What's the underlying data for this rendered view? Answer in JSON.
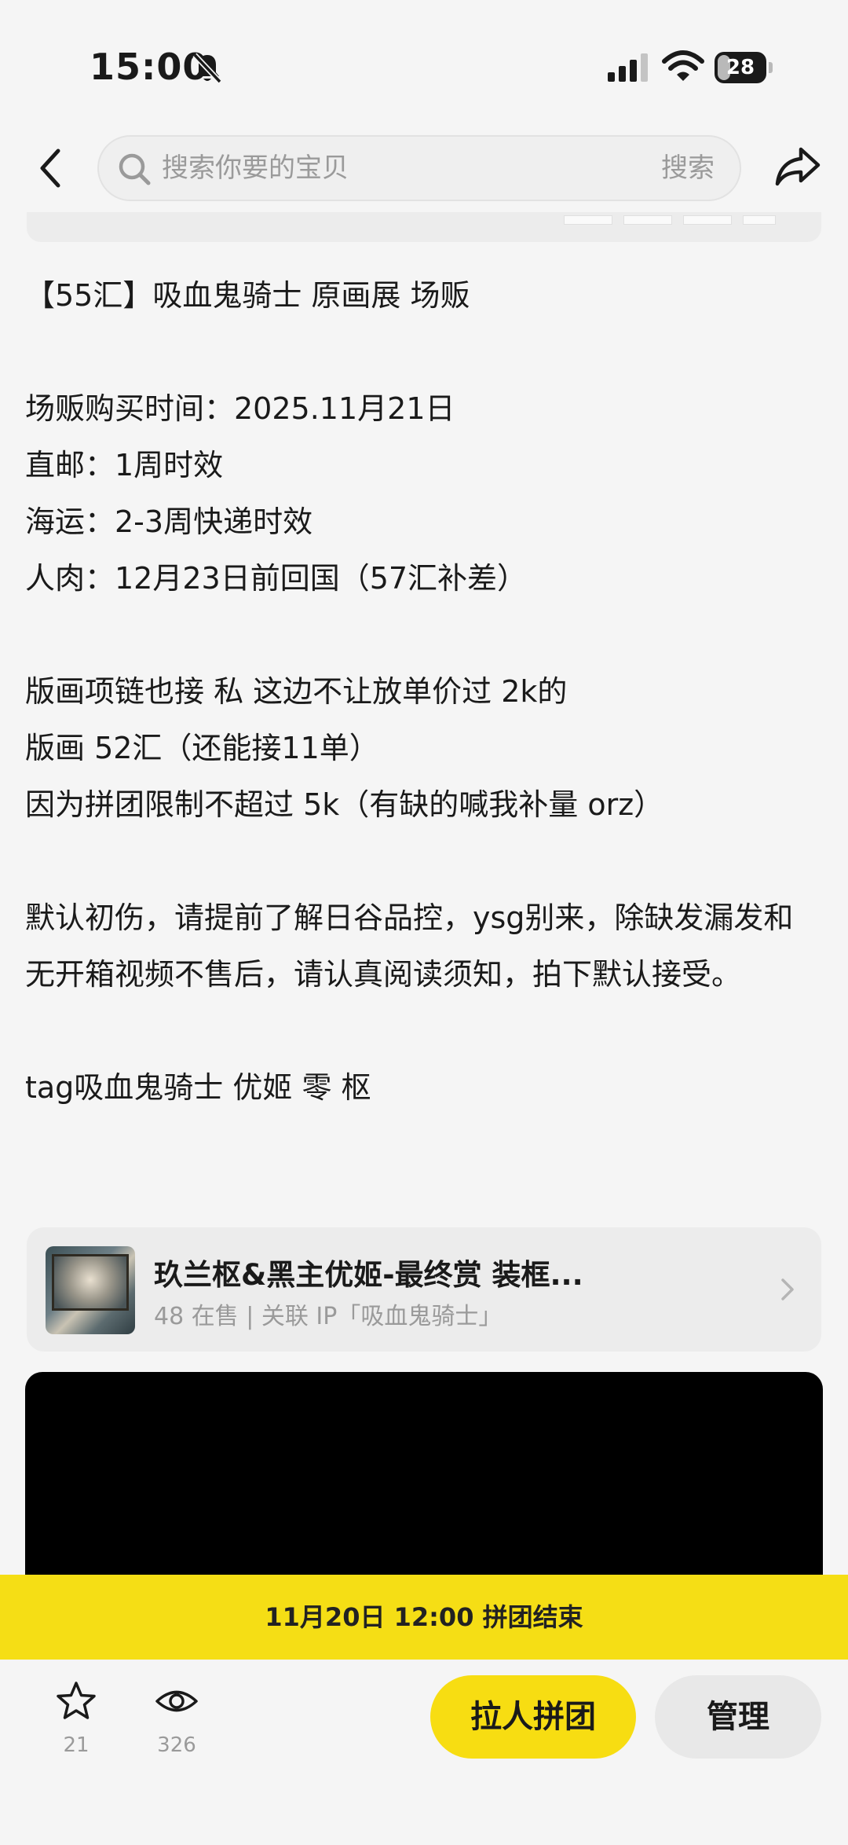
{
  "status_bar": {
    "time": "15:00",
    "battery": "28",
    "battery_level": 0.28
  },
  "search": {
    "placeholder": "搜索你要的宝贝",
    "action_label": "搜索"
  },
  "description": {
    "title_line": "【55汇】吸血鬼骑士  原画展 场贩",
    "purchase_time": "场贩购买时间：2025.11月21日",
    "direct_mail": "直邮：1周时效",
    "sea_freight": "海运：2-3周快递时效",
    "hand_carry": "人肉：12月23日前回国（57汇补差）",
    "note_line1": "版画项链也接 私 这边不让放单价过 2k的",
    "note_line2": "版画 52汇（还能接11单）",
    "note_line3": "因为拼团限制不超过 5k（有缺的喊我补量 orz）",
    "terms": "默认初伤，请提前了解日谷品控，ysg别来，除缺发漏发和无开箱视频不售后，请认真阅读须知，拍下默认接受。",
    "tags": "tag吸血鬼骑士 优姬 零 枢"
  },
  "linked_product": {
    "title": "玖兰枢&黑主优姬-最终赏 装框...",
    "subtitle": "48 在售 | 关联 IP「吸血鬼骑士」"
  },
  "deadline_banner": "11月20日 12:00 拼团结束",
  "bottom_bar": {
    "favorites_count": "21",
    "views_count": "326",
    "group_button_label": "拉人拼团",
    "manage_button_label": "管理"
  },
  "colors": {
    "accent_yellow": "#f5de15",
    "button_yellow": "#f7dd12",
    "background": "#f5f5f5"
  }
}
